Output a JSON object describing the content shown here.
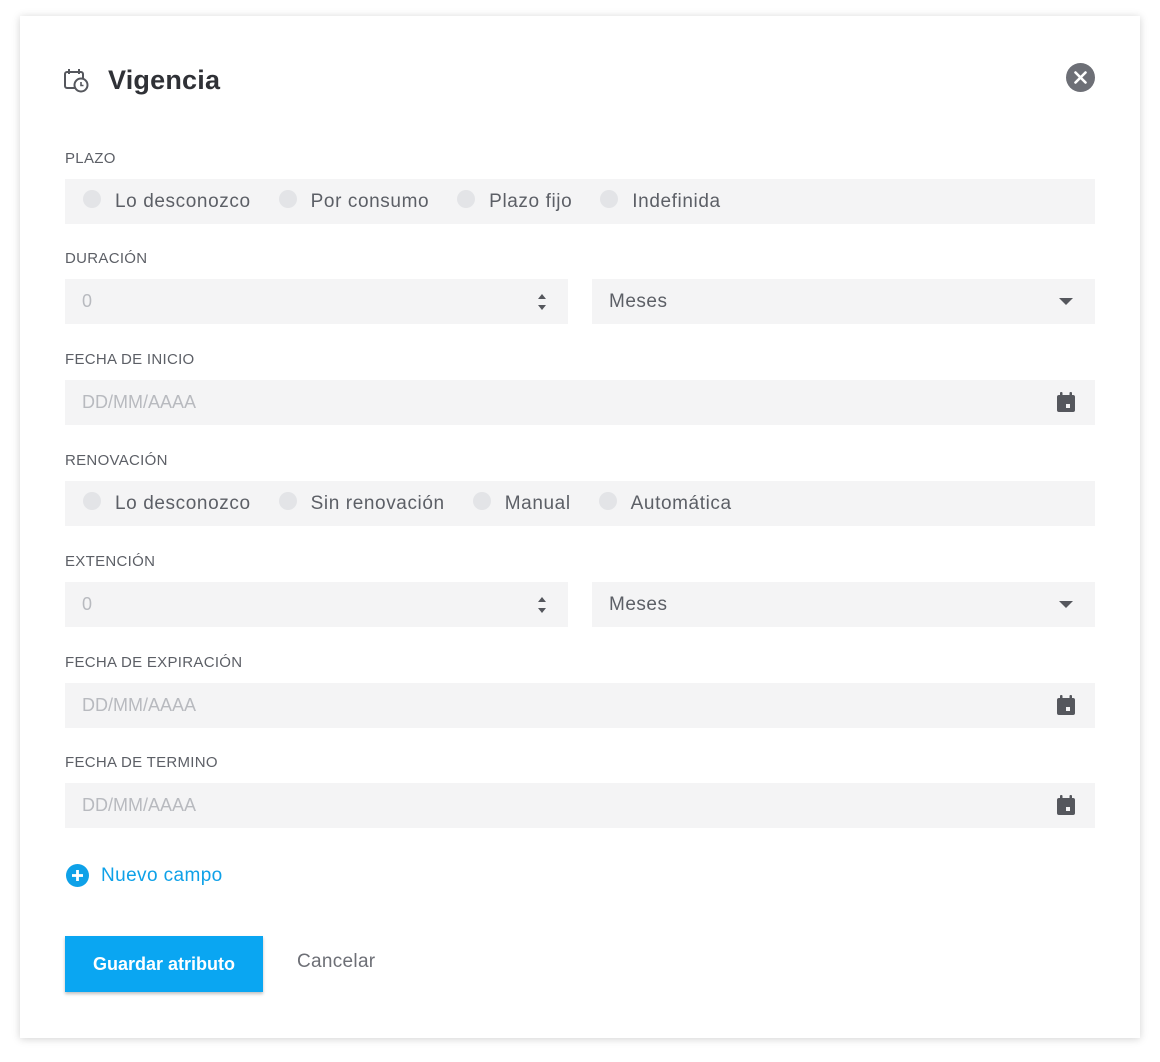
{
  "dialog": {
    "title": "Vigencia",
    "header_icon": "calendar-clock-icon",
    "close_icon": "close-icon"
  },
  "plazo": {
    "label": "PLAZO",
    "options": [
      "Lo desconozco",
      "Por consumo",
      "Plazo fijo",
      "Indefinida"
    ]
  },
  "duracion": {
    "label": "DURACIÓN",
    "number_value": "0",
    "unit_value": "Meses"
  },
  "fecha_inicio": {
    "label": "FECHA DE INICIO",
    "placeholder": "DD/MM/AAAA"
  },
  "renovacion": {
    "label": "RENOVACIÓN",
    "options": [
      "Lo desconozco",
      "Sin renovación",
      "Manual",
      "Automática"
    ]
  },
  "extencion": {
    "label": "EXTENCIÓN",
    "number_value": "0",
    "unit_value": "Meses"
  },
  "fecha_expiracion": {
    "label": "FECHA DE EXPIRACIÓN",
    "placeholder": "DD/MM/AAAA"
  },
  "fecha_termino": {
    "label": "FECHA DE TERMINO",
    "placeholder": "DD/MM/AAAA"
  },
  "actions": {
    "add_field_label": "Nuevo campo",
    "save_label": "Guardar atributo",
    "cancel_label": "Cancelar"
  },
  "colors": {
    "accent": "#0aa6f2",
    "field_bg": "#f4f4f5",
    "text": "#5c5f66",
    "title": "#2f3136"
  }
}
